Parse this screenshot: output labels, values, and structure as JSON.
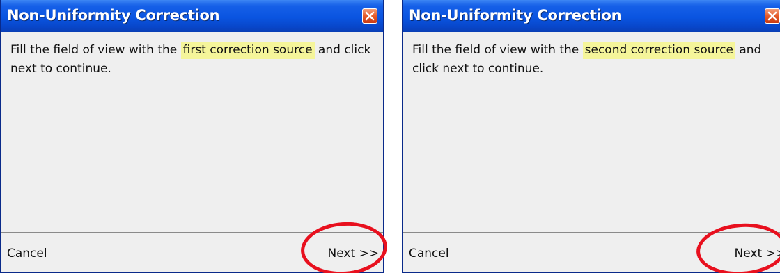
{
  "dialogs": [
    {
      "title": "Non-Uniformity Correction",
      "text_before": "Fill the field of view with the ",
      "highlight": "first correction source",
      "text_after": " and click next to continue.",
      "cancel_label": "Cancel",
      "next_label": "Next >>"
    },
    {
      "title": "Non-Uniformity Correction",
      "text_before": "Fill the field of view with the ",
      "highlight": "second correction source",
      "text_after": " and click next to continue.",
      "cancel_label": "Cancel",
      "next_label": "Next >>"
    }
  ],
  "icons": {
    "close": "close-icon"
  },
  "colors": {
    "titlebar": "#0a54e0",
    "highlight": "#f5f59a",
    "annotation_circle": "#e8101e",
    "close_button": "#e55b2a"
  }
}
